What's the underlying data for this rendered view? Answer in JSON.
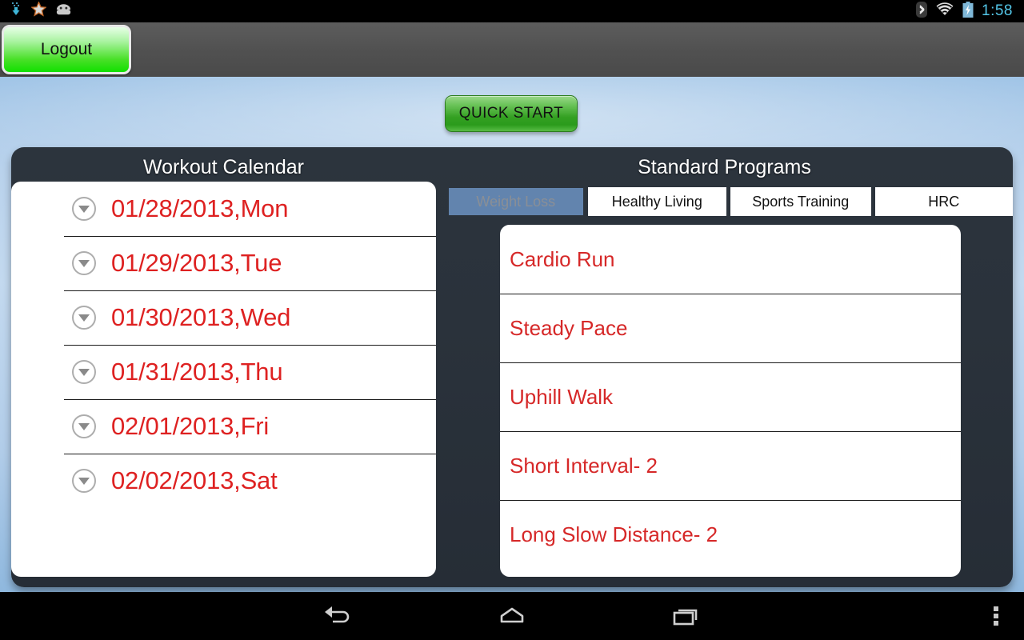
{
  "status_bar": {
    "icons": [
      "download-icon",
      "star-icon",
      "android-icon"
    ],
    "right_icons": [
      "bluetooth-icon",
      "wifi-icon",
      "battery-charging-icon"
    ],
    "time": "1:58"
  },
  "action_bar": {
    "logout_label": "Logout"
  },
  "main": {
    "quick_start_label": "QUICK START",
    "calendar": {
      "title": "Workout Calendar",
      "items": [
        {
          "label": "01/28/2013,Mon"
        },
        {
          "label": "01/29/2013,Tue"
        },
        {
          "label": "01/30/2013,Wed"
        },
        {
          "label": "01/31/2013,Thu"
        },
        {
          "label": "02/01/2013,Fri"
        },
        {
          "label": "02/02/2013,Sat"
        }
      ]
    },
    "programs": {
      "title": "Standard Programs",
      "tabs": [
        {
          "label": "Weight Loss",
          "selected": true
        },
        {
          "label": "Healthy Living",
          "selected": false
        },
        {
          "label": "Sports Training",
          "selected": false
        },
        {
          "label": "HRC",
          "selected": false
        }
      ],
      "items": [
        {
          "label": "Cardio Run"
        },
        {
          "label": "Steady Pace"
        },
        {
          "label": "Uphill Walk"
        },
        {
          "label": "Short Interval- 2"
        },
        {
          "label": "Long Slow Distance- 2"
        }
      ]
    }
  },
  "nav_bar": {
    "buttons": [
      "back-icon",
      "home-icon",
      "recent-apps-icon",
      "overflow-menu-icon"
    ]
  },
  "colors": {
    "accent_red": "#de2121",
    "program_red": "#d62828",
    "tab_selected_bg": "#6284ae",
    "panel_dark": "#2c343d",
    "logout_green": "#11e000",
    "status_time_blue": "#53c6e8"
  }
}
